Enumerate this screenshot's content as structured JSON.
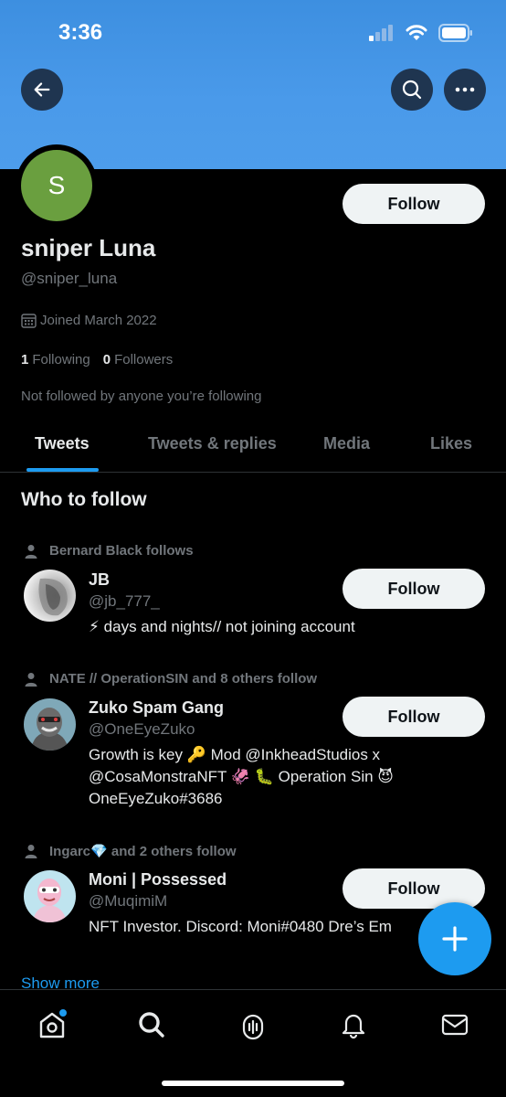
{
  "status_bar": {
    "time": "3:36"
  },
  "profile": {
    "avatar_initial": "S",
    "name": "sniper Luna",
    "handle": "@sniper_luna",
    "joined": "Joined March 2022",
    "following_count": "1",
    "following_label": "Following",
    "followers_count": "0",
    "followers_label": "Followers",
    "not_followed": "Not followed by anyone you’re following",
    "follow_label": "Follow"
  },
  "tabs": [
    "Tweets",
    "Tweets & replies",
    "Media",
    "Likes"
  ],
  "who_to_follow": {
    "title": "Who to follow",
    "items": [
      {
        "social": "Bernard Black follows",
        "name": "JB",
        "handle": "@jb_777_",
        "bio": "⚡ days and nights// not joining account",
        "follow_label": "Follow"
      },
      {
        "social": "NATE // OperationSIN and 8 others follow",
        "name": "Zuko Spam Gang",
        "handle": "@OneEyeZuko",
        "bio": "Growth is key 🔑 Mod @InkheadStudios x\n@CosaMonstraNFT 🦑 🐛 Operation Sin 😈\nOneEyeZuko#3686",
        "follow_label": "Follow"
      },
      {
        "social": "Ingarc💎 and 2 others follow",
        "name": "Moni | Possessed",
        "handle": "@MuqimiM",
        "bio": "NFT Investor. Discord: Moni#0480 Dre’s Em",
        "follow_label": "Follow"
      }
    ],
    "show_more": "Show more"
  },
  "icons": {
    "back": "back-arrow-icon",
    "search": "search-icon",
    "more": "more-icon",
    "compose": "plus-icon",
    "nav": [
      "home-icon",
      "search-icon",
      "spaces-icon",
      "bell-icon",
      "mail-icon"
    ]
  },
  "colors": {
    "accent": "#1d9bf0",
    "banner": "#4a9aea",
    "avatar": "#6a9f3f"
  }
}
